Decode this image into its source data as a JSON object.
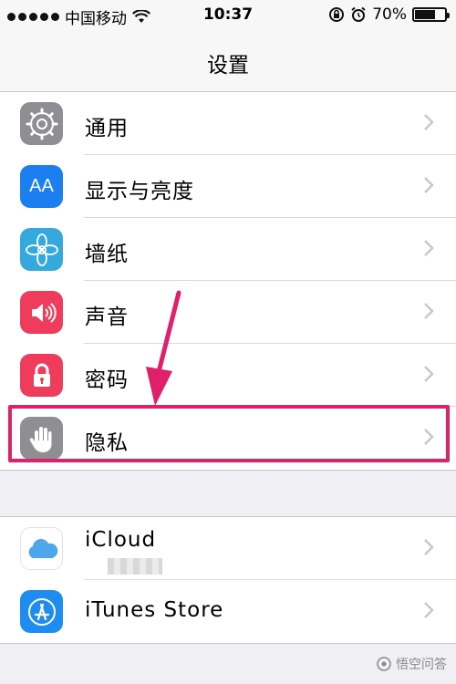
{
  "status_bar": {
    "carrier": "中国移动",
    "time": "10:37",
    "battery_percent_label": "70%",
    "battery_level": 0.7
  },
  "nav": {
    "title": "设置"
  },
  "settings": [
    {
      "label": "通用",
      "icon": "gear-icon",
      "color": "#8e8e93"
    },
    {
      "label": "显示与亮度",
      "icon": "text-size-icon",
      "color": "#1b7ff0"
    },
    {
      "label": "墙纸",
      "icon": "flower-icon",
      "color": "#35a9de"
    },
    {
      "label": "声音",
      "icon": "speaker-icon",
      "color": "#ef3b5c"
    },
    {
      "label": "密码",
      "icon": "lock-icon",
      "color": "#ef3b5c"
    },
    {
      "label": "隐私",
      "icon": "hand-icon",
      "color": "#8e8e93"
    }
  ],
  "accounts": [
    {
      "label": "iCloud",
      "icon": "cloud-icon",
      "color": "#ffffff"
    },
    {
      "label": "iTunes Store",
      "icon": "app-store-icon",
      "color": "#1f8cf0"
    }
  ],
  "icon_texts": {
    "display": "AA"
  },
  "annotation": {
    "highlight_color": "#e0206b"
  },
  "watermark": {
    "text": "悟空问答"
  }
}
